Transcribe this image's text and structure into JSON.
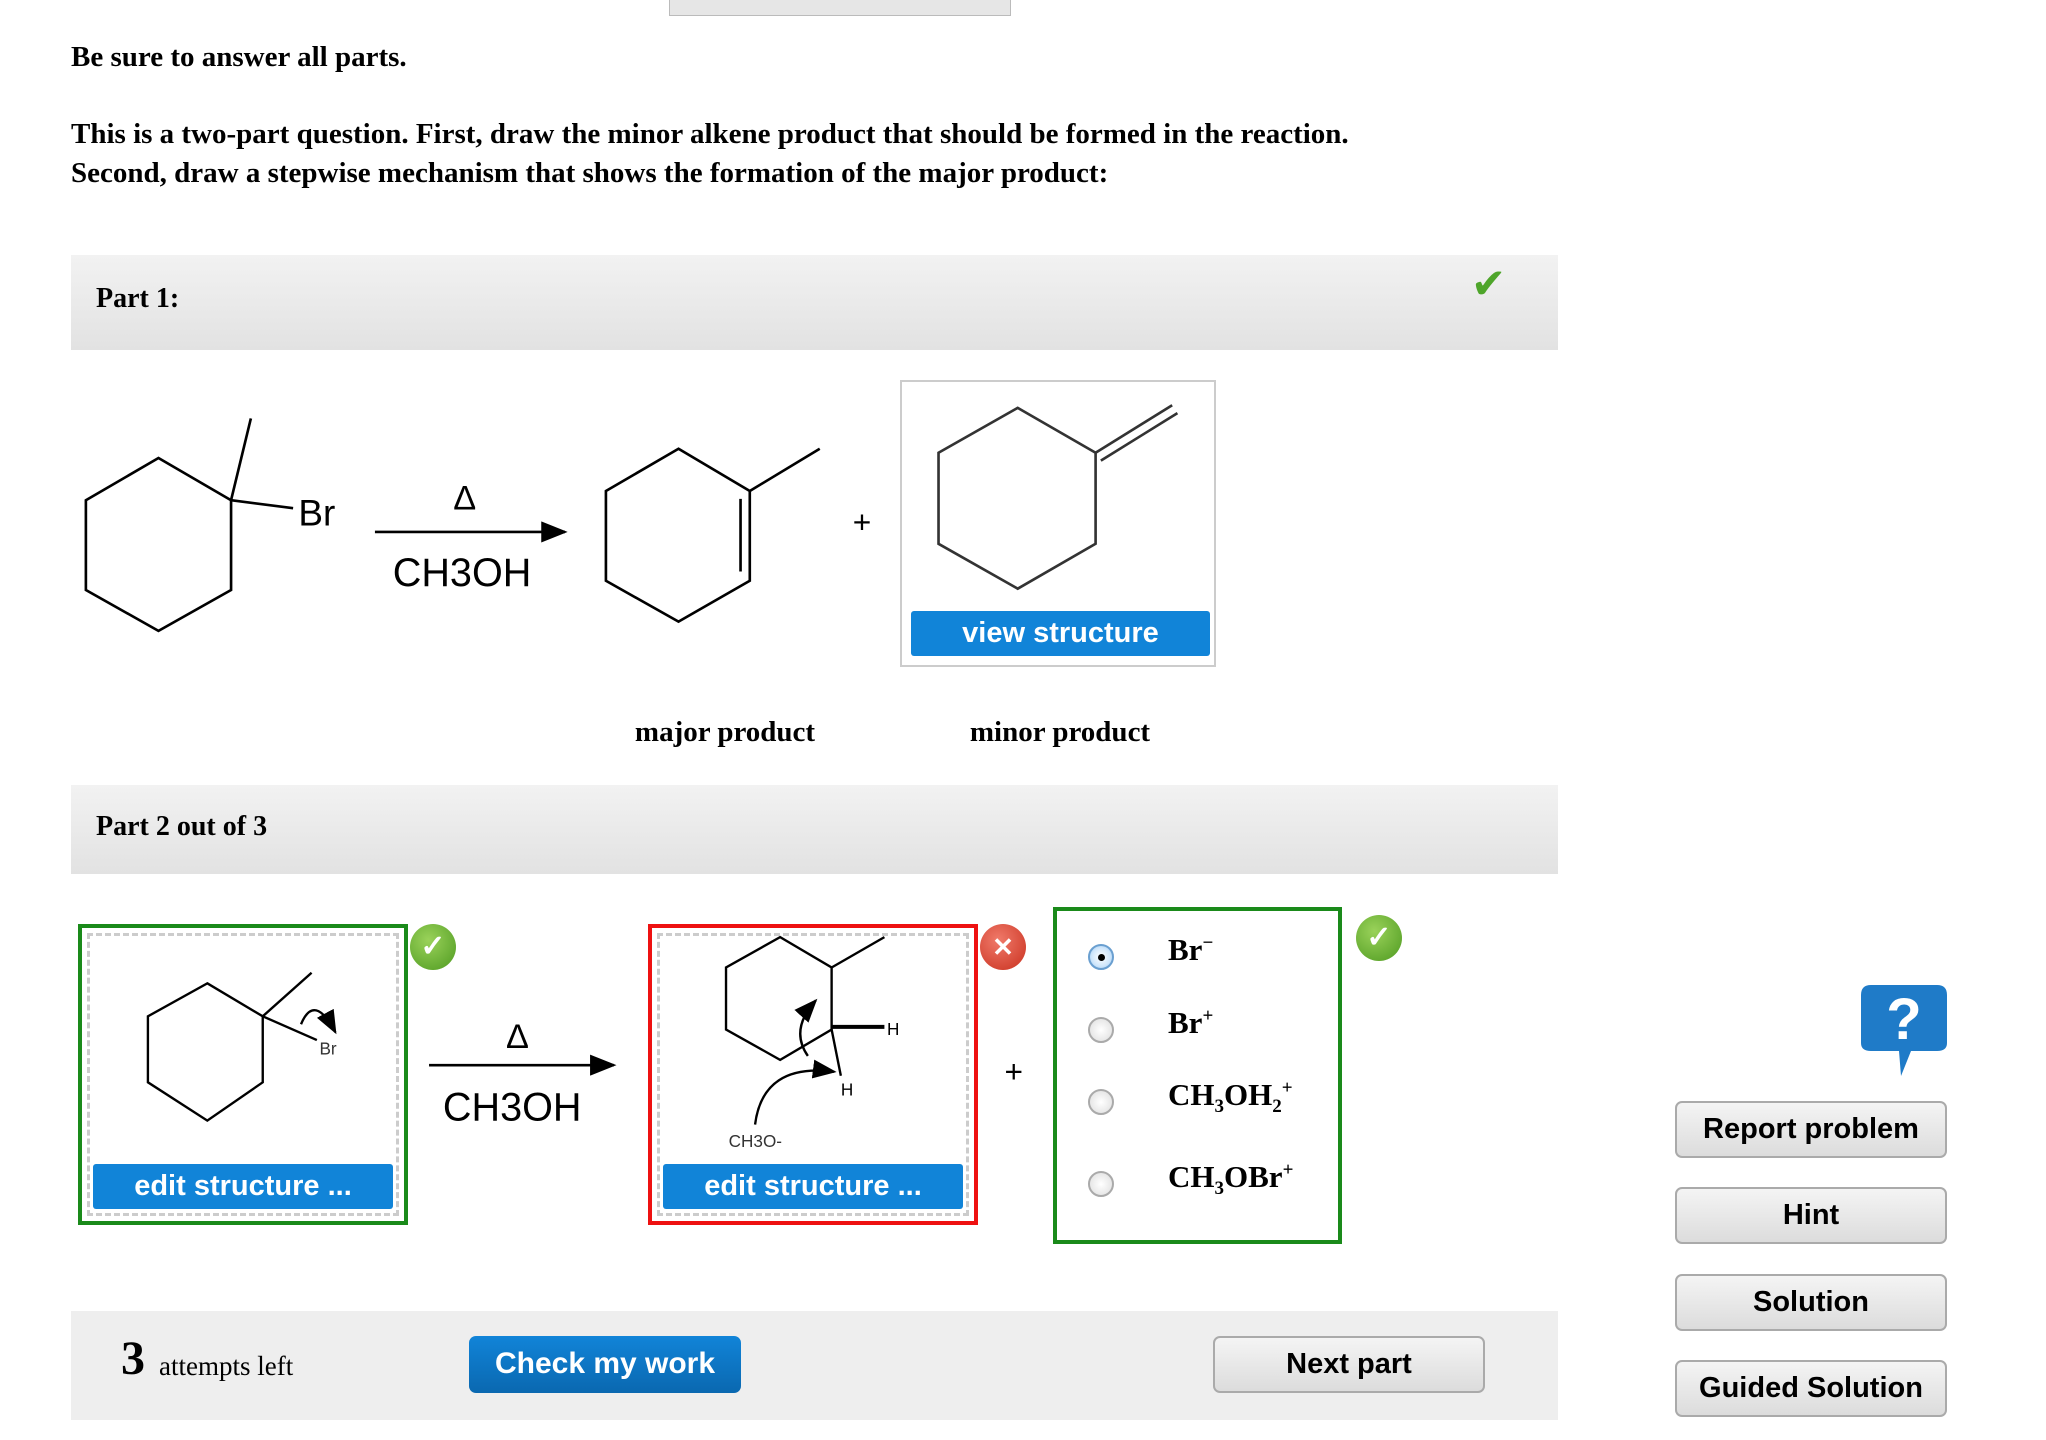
{
  "instructions": {
    "line1": "Be sure to answer all parts.",
    "line2": "This is a two-part question. First, draw the minor alkene product that should be formed in the reaction.",
    "line3": "Second, draw a stepwise mechanism that shows the formation of the major product:"
  },
  "part1": {
    "title": "Part 1:",
    "status_icon": "checkmark-icon",
    "reactant_label": "Br",
    "condition_top": "Δ",
    "condition_bottom": "CH3OH",
    "plus": "+",
    "view_structure_label": "view structure",
    "major_label": "major product",
    "minor_label": "minor product"
  },
  "part2": {
    "title": "Part 2 out of 3",
    "box1": {
      "atom_label": "Br",
      "edit_label": "edit structure ...",
      "status": "correct"
    },
    "condition_top": "Δ",
    "condition_bottom": "CH3OH",
    "box2": {
      "h_label_1": "H",
      "h_label_2": "H",
      "base_label": "CH3O-",
      "edit_label": "edit structure ...",
      "status": "incorrect"
    },
    "plus": "+",
    "options": [
      {
        "base": "Br",
        "sub": "",
        "tail": "",
        "sup": "−",
        "selected": true
      },
      {
        "base": "Br",
        "sub": "",
        "tail": "",
        "sup": "+",
        "selected": false
      },
      {
        "base": "CH",
        "sub": "3",
        "tail": "OH",
        "sub2": "2",
        "sup": "+",
        "selected": false
      },
      {
        "base": "CH",
        "sub": "3",
        "tail": "OBr",
        "sup": "+",
        "selected": false
      }
    ],
    "options_status": "correct"
  },
  "footer": {
    "attempts_count": "3",
    "attempts_label": "attempts left",
    "check_label": "Check my work",
    "next_label": "Next part"
  },
  "sidebar": {
    "help_icon": "help-question-icon",
    "buttons": [
      "Report problem",
      "Hint",
      "Solution",
      "Guided Solution"
    ]
  },
  "colors": {
    "accent_blue": "#1184d8",
    "correct_green": "#1a8a1a",
    "incorrect_red": "#ee1111",
    "check_green": "#6aaa2a"
  }
}
